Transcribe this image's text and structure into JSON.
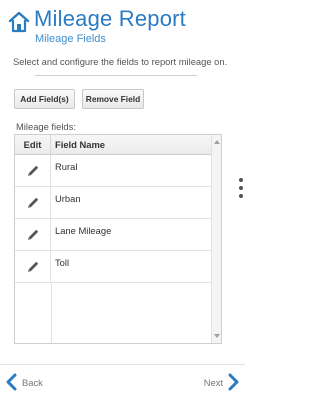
{
  "header": {
    "title": "Mileage Report",
    "subtitle": "Mileage Fields"
  },
  "instructions": "Select and configure the fields to report mileage on.",
  "toolbar": {
    "add_label": "Add Field(s)",
    "remove_label": "Remove Field"
  },
  "grid": {
    "label": "Mileage fields:",
    "columns": {
      "edit": "Edit",
      "name": "Field Name"
    },
    "rows": [
      {
        "name": "Rural"
      },
      {
        "name": "Urban"
      },
      {
        "name": "Lane Mileage"
      },
      {
        "name": "Toll"
      }
    ]
  },
  "footer": {
    "back_label": "Back",
    "next_label": "Next"
  },
  "colors": {
    "accent": "#2b7bc1",
    "subtitle": "#3f8fd0"
  },
  "icons": {
    "home": "home-icon",
    "edit": "pencil-icon",
    "back": "chevron-left-icon",
    "next": "chevron-right-icon",
    "more": "vertical-dots-icon"
  }
}
